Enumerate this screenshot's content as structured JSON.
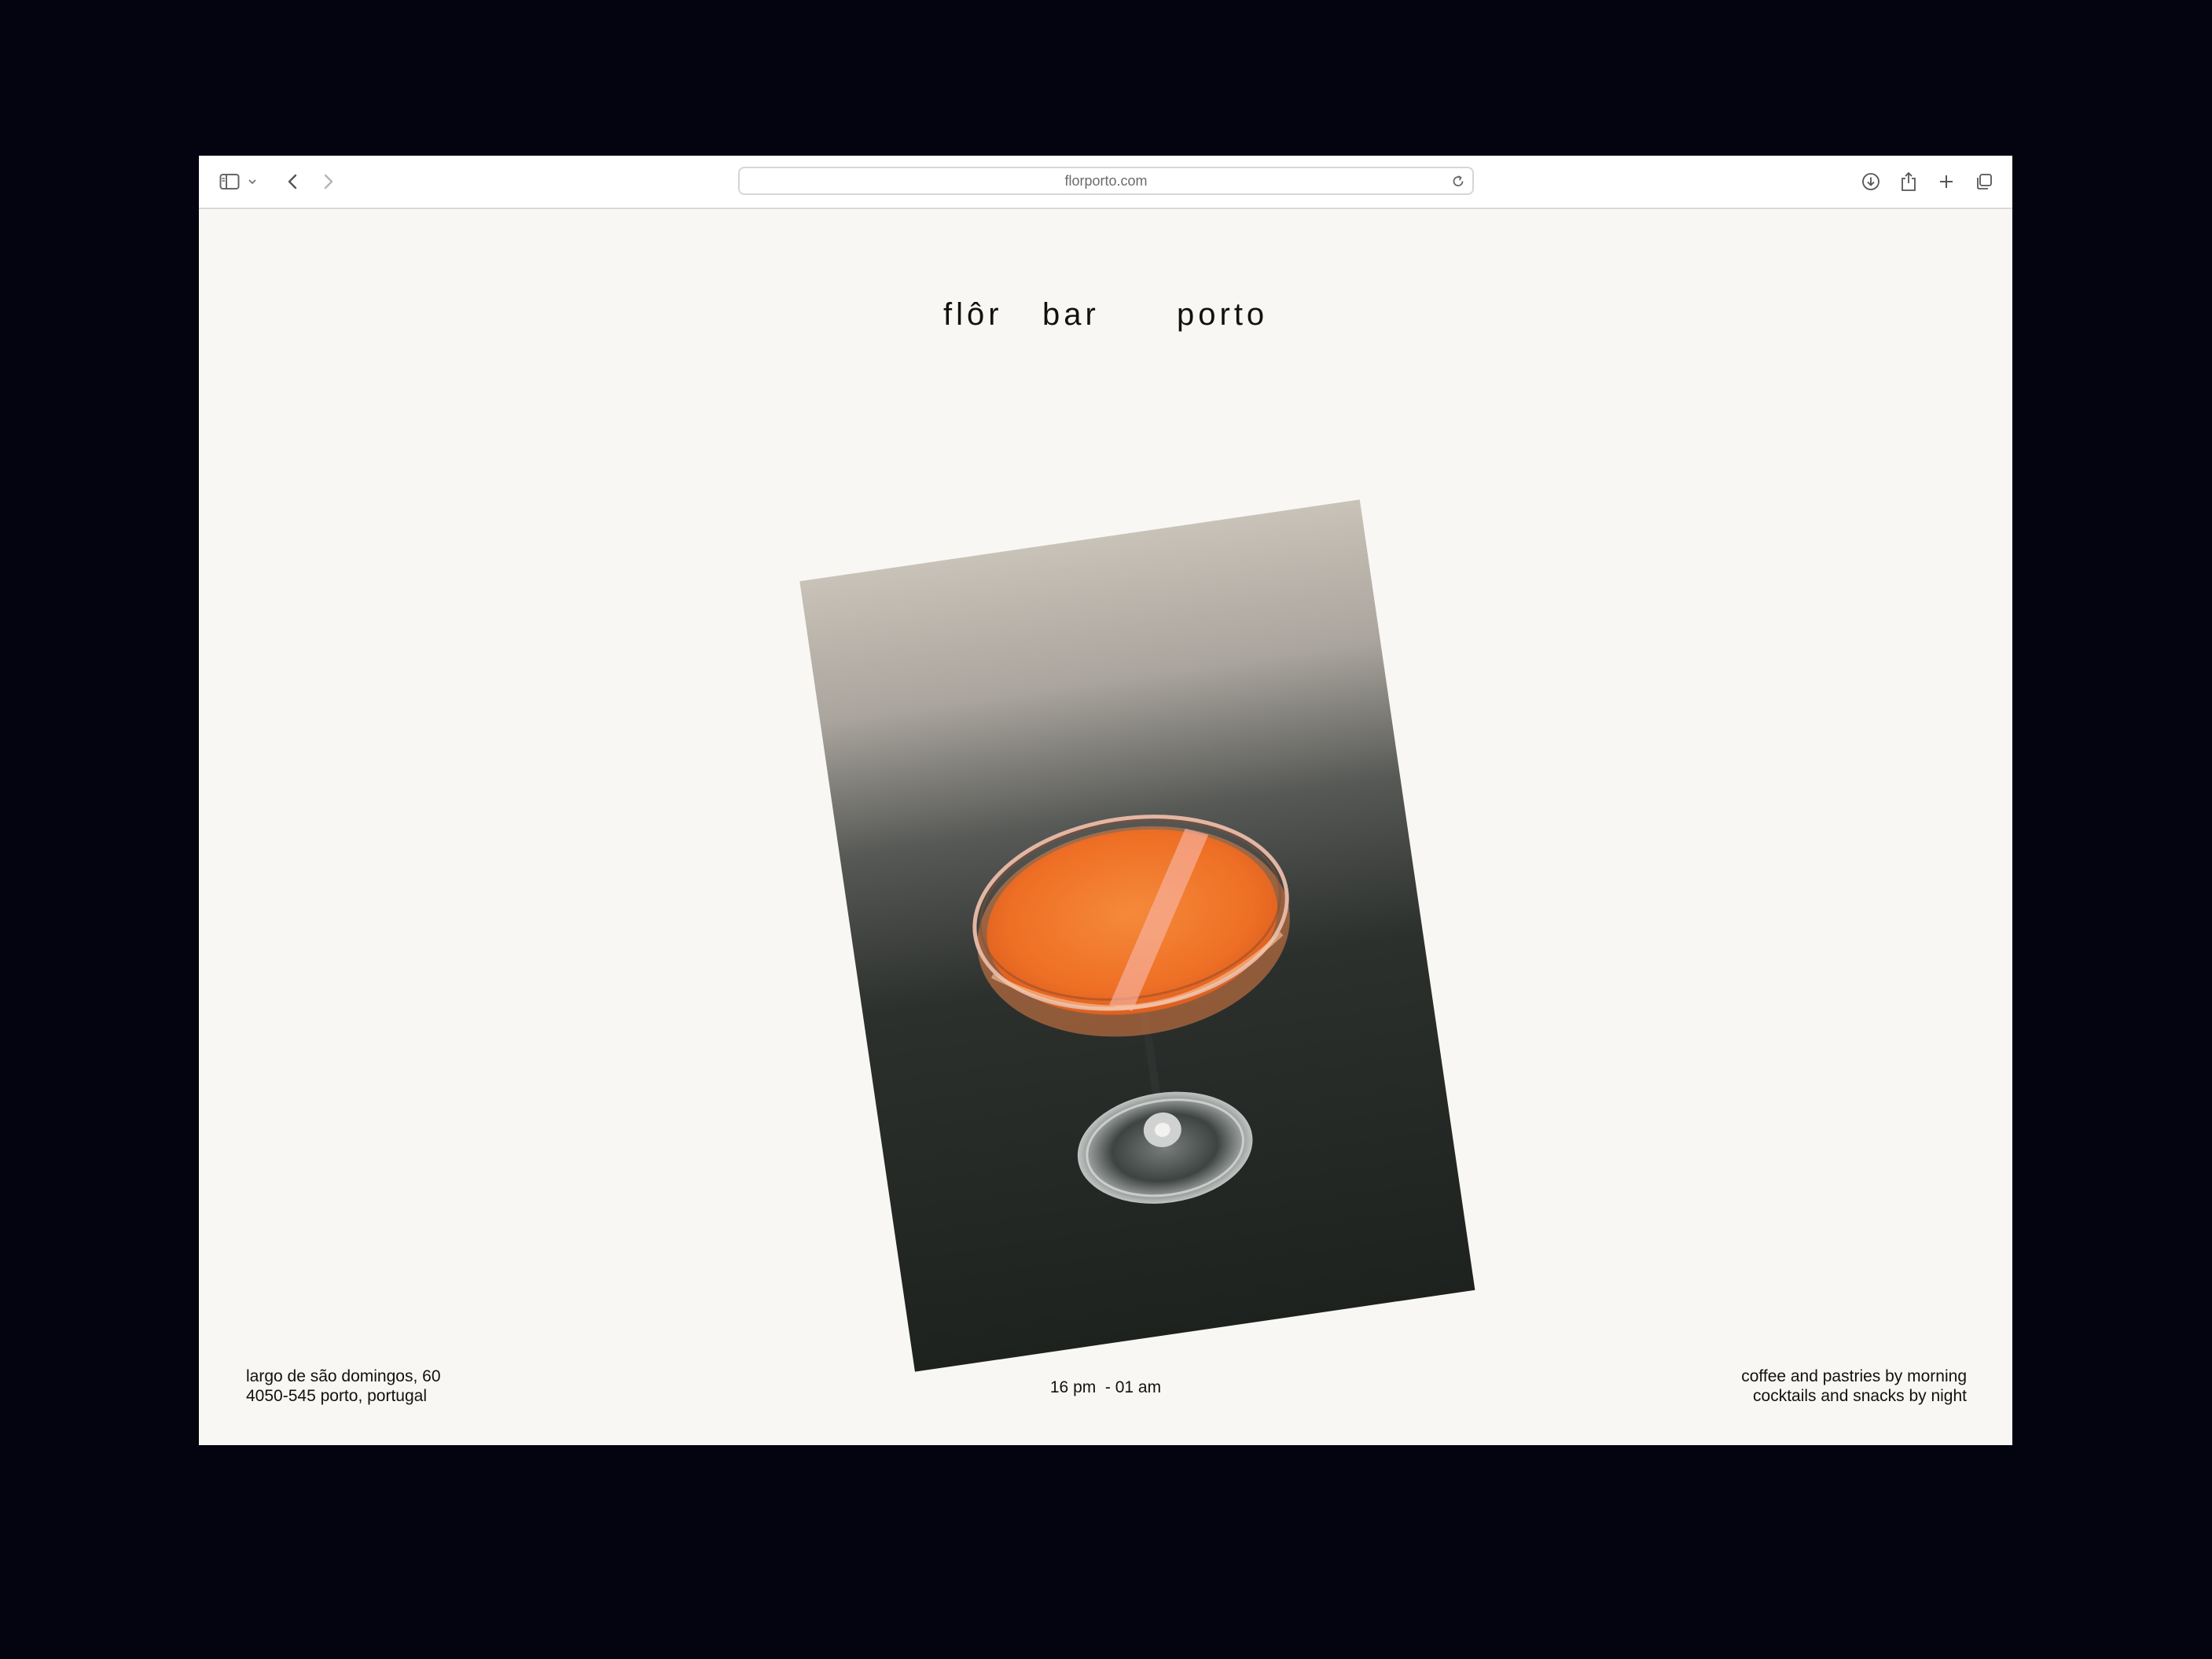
{
  "browser": {
    "url": "florporto.com",
    "icons": {
      "sidebar": "sidebar-icon",
      "sidebar_menu": "chevron-down-icon",
      "back": "chevron-left-icon",
      "forward": "chevron-right-icon",
      "reload": "reload-icon",
      "downloads": "download-icon",
      "share": "share-icon",
      "new_tab": "plus-icon",
      "tabs": "tabs-overview-icon"
    }
  },
  "header": {
    "word_1": "flôr",
    "word_2": "bar",
    "word_3": "porto"
  },
  "footer": {
    "address_line_1": "largo de são domingos, 60",
    "address_line_2": "4050-545 porto, portugal",
    "hours": "16 pm  - 01 am",
    "tagline_1": "coffee and pastries by morning",
    "tagline_2": "cocktails and snacks by night"
  },
  "colors": {
    "backdrop": "#03040f",
    "page": "#f8f7f3",
    "cocktail": "#f07a2c"
  }
}
